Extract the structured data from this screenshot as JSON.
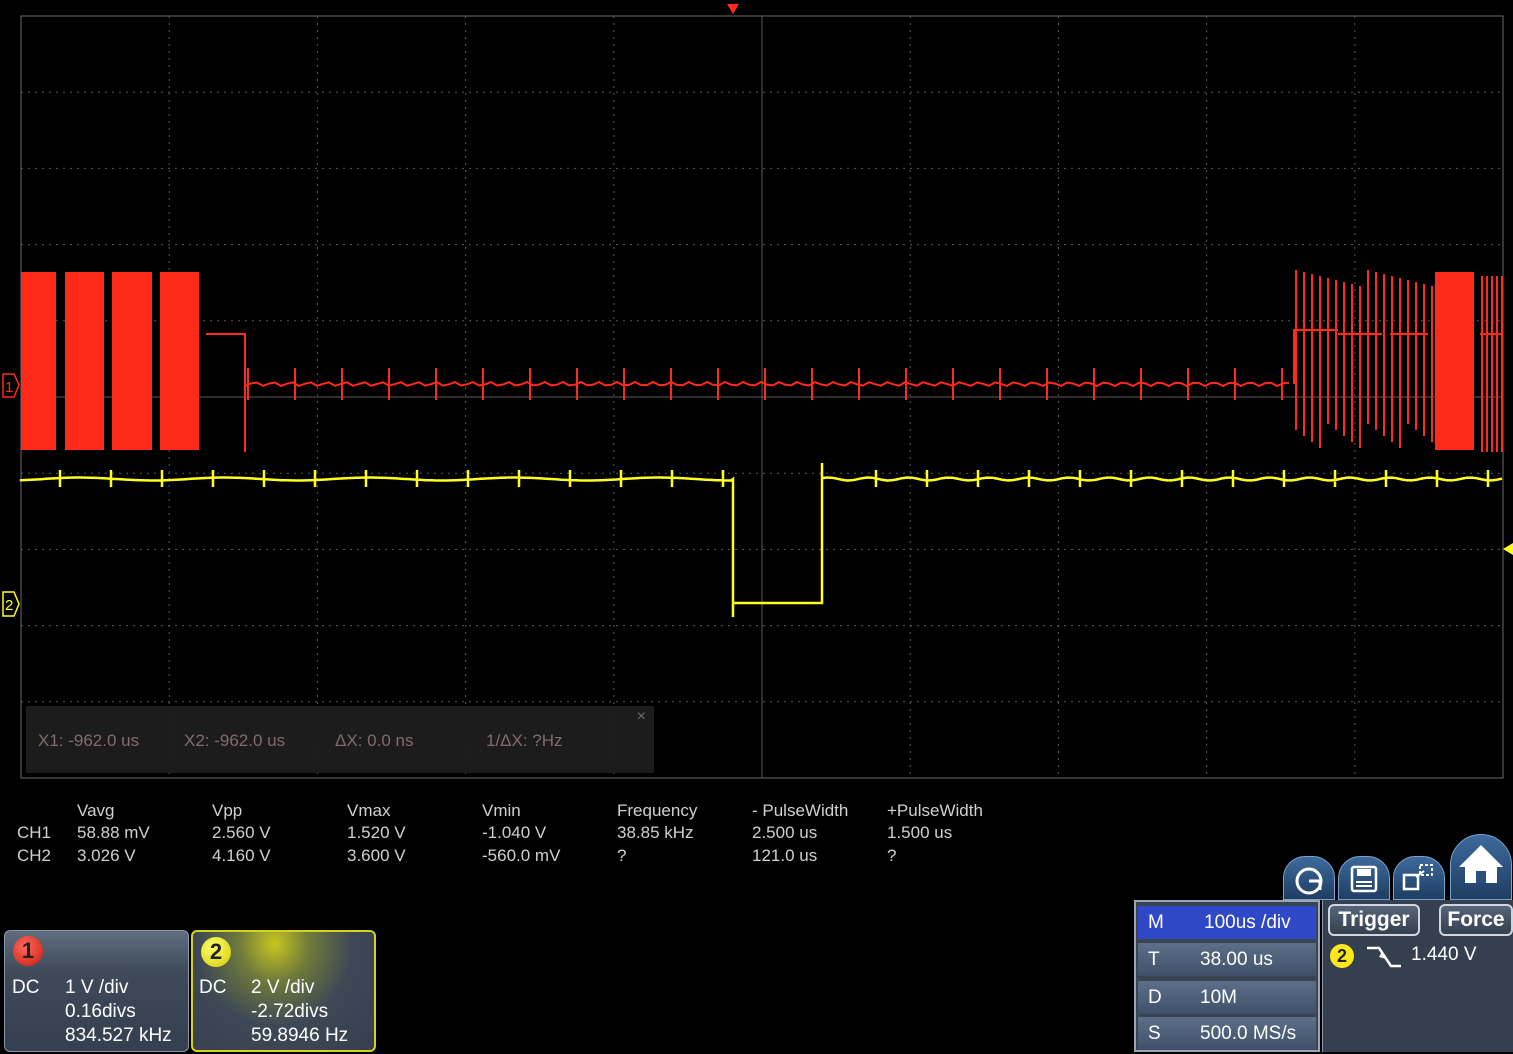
{
  "channel_markers": {
    "ch1": "1",
    "ch2": "2"
  },
  "measurements": {
    "headers": [
      "Vavg",
      "Vpp",
      "Vmax",
      "Vmin",
      "Frequency",
      "- PulseWidth",
      "+PulseWidth"
    ],
    "rows": [
      {
        "label": "CH1",
        "values": [
          "58.88 mV",
          "2.560 V",
          "1.520 V",
          "-1.040 V",
          "38.85 kHz",
          "2.500 us",
          "1.500 us"
        ]
      },
      {
        "label": "CH2",
        "values": [
          "3.026 V",
          "4.160 V",
          "3.600 V",
          "-560.0 mV",
          "?",
          "121.0 us",
          "?"
        ]
      }
    ]
  },
  "cursor_readout": {
    "x1": "X1: -962.0 us",
    "x2": "X2: -962.0 us",
    "dx": "ΔX: 0.0 ns",
    "inv_dx": "1/ΔX: ?Hz",
    "close": "×"
  },
  "ch1": {
    "badge": "1",
    "coupling": "DC",
    "scale": "1 V /div",
    "offset": "0.16divs",
    "freq": "834.527 kHz",
    "color": "#ff2a1a"
  },
  "ch2": {
    "badge": "2",
    "coupling": "DC",
    "scale": "2 V /div",
    "offset": "-2.72divs",
    "freq": "59.8946 Hz",
    "color": "#ffff1e"
  },
  "timebase": {
    "m_label": "M",
    "m_value": "100us /div",
    "t_label": "T",
    "t_value": "38.00 us",
    "d_label": "D",
    "d_value": "10M",
    "s_label": "S",
    "s_value": "500.0 MS/s"
  },
  "trigger": {
    "button": "Trigger",
    "force": "Force",
    "source": "2",
    "level": "1.440 V"
  },
  "toolbar": {
    "icons": [
      "autoset-icon",
      "save-icon",
      "screen-capture-icon",
      "home-icon"
    ]
  },
  "colors": {
    "grid": "#5a5a5a",
    "background": "#000000",
    "panel": "#34404f",
    "accent_blue": "#2f48c8"
  }
}
